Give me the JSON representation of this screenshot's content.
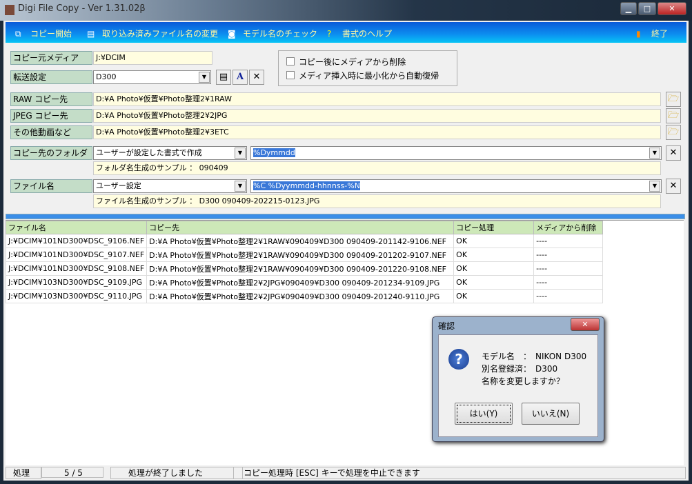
{
  "window": {
    "title": "Digi File Copy  - Ver 1.31.02β",
    "min": "▁",
    "max": "□",
    "close": "✕"
  },
  "toolbar": {
    "start": "コピー開始",
    "rename": "取り込み済みファイル名の変更",
    "model_check": "モデル名のチェック",
    "help": "書式のヘルプ",
    "exit": "終了"
  },
  "form": {
    "source_label": "コピー元メディア",
    "source_value": "J:¥DCIM",
    "transfer_label": "転送設定",
    "transfer_value": "D300",
    "delete_after_copy": "コピー後にメディアから削除",
    "auto_restore": "メディア挿入時に最小化から自動復帰",
    "raw_label": "RAW コピー先",
    "raw_value": "D:¥A Photo¥仮置¥Photo整理2¥1RAW",
    "jpeg_label": "JPEG コピー先",
    "jpeg_value": "D:¥A Photo¥仮置¥Photo整理2¥2JPG",
    "other_label": "その他動画など",
    "other_value": "D:¥A Photo¥仮置¥Photo整理2¥3ETC",
    "folder_label": "コピー先のフォルダ",
    "folder_mode": "ユーザーが設定した書式で作成",
    "folder_format": "%Dymmdd",
    "folder_sample": "フォルダ名生成のサンプル ： 090409",
    "filename_label": "ファイル名",
    "filename_mode": "ユーザー設定",
    "filename_format": "%C %Dyymmdd-hhnnss-%N",
    "filename_sample": "ファイル名生成のサンプル ： D300 090409-202215-0123.JPG"
  },
  "table": {
    "headers": [
      "ファイル名",
      "コピー先",
      "コピー処理",
      "メディアから削除"
    ],
    "rows": [
      [
        "J:¥DCIM¥101ND300¥DSC_9106.NEF",
        "D:¥A Photo¥仮置¥Photo整理2¥1RAW¥090409¥D300 090409-201142-9106.NEF",
        "OK",
        "----"
      ],
      [
        "J:¥DCIM¥101ND300¥DSC_9107.NEF",
        "D:¥A Photo¥仮置¥Photo整理2¥1RAW¥090409¥D300 090409-201202-9107.NEF",
        "OK",
        "----"
      ],
      [
        "J:¥DCIM¥101ND300¥DSC_9108.NEF",
        "D:¥A Photo¥仮置¥Photo整理2¥1RAW¥090409¥D300 090409-201220-9108.NEF",
        "OK",
        "----"
      ],
      [
        "J:¥DCIM¥103ND300¥DSC_9109.JPG",
        "D:¥A Photo¥仮置¥Photo整理2¥2JPG¥090409¥D300 090409-201234-9109.JPG",
        "OK",
        "----"
      ],
      [
        "J:¥DCIM¥103ND300¥DSC_9110.JPG",
        "D:¥A Photo¥仮置¥Photo整理2¥2JPG¥090409¥D300 090409-201240-9110.JPG",
        "OK",
        "----"
      ]
    ]
  },
  "status": {
    "label": "処理",
    "progress": "5 / 5",
    "message": "処理が終了しました",
    "hint": "コピー処理時 [ESC] キーで処理を中止できます"
  },
  "dialog": {
    "title": "確認",
    "line1": "モデル名　：　NIKON D300",
    "line2": "別名登録済：　D300",
    "line3": "名称を変更しますか？",
    "yes": "はい(Y)",
    "no": "いいえ(N)",
    "close": "✕"
  }
}
